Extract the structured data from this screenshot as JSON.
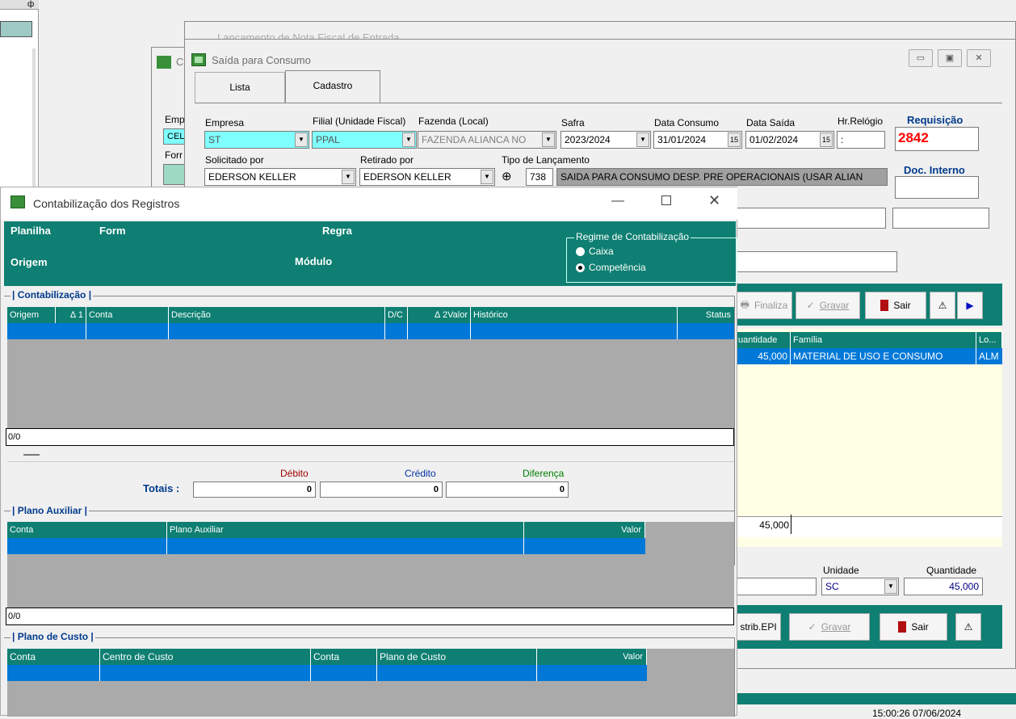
{
  "bg_window_title": "Lançamento de Nota Fiscal de Entrada",
  "small_window_title": "C",
  "small_window": {
    "emp_label": "Emp",
    "emp_value": "CEL",
    "form_label": "Forr"
  },
  "main_window": {
    "title": "Saída para Consumo",
    "tabs": [
      "Lista",
      "Cadastro"
    ],
    "labels": {
      "empresa": "Empresa",
      "filial": "Filial (Unidade Fiscal)",
      "fazenda": "Fazenda (Local)",
      "safra": "Safra",
      "data_consumo": "Data Consumo",
      "data_saida": "Data Saída",
      "hr_relogio": "Hr.Relógio",
      "requisicao": "Requisição",
      "solicitado": "Solicitado por",
      "retirado": "Retirado por",
      "tipo_lanc": "Tipo de Lançamento",
      "doc_interno": "Doc. Interno"
    },
    "values": {
      "empresa": "ST",
      "filial": "PPAL",
      "fazenda": "FAZENDA ALIANCA NO",
      "safra": "2023/2024",
      "data_consumo": "31/01/2024",
      "data_saida": "01/02/2024",
      "hr_relogio": ":",
      "requisicao": "2842",
      "solicitado": "EDERSON KELLER",
      "retirado": "EDERSON KELLER",
      "tipo_codigo": "738",
      "tipo_desc": "SAIDA PARA CONSUMO DESP. PRE OPERACIONAIS (USAR  ALIAN"
    },
    "toolbar": {
      "finaliza": "Finaliza",
      "gravar": "Gravar",
      "sair": "Sair"
    },
    "grid": {
      "headers": [
        "uantidade",
        "Família",
        "Lo..."
      ],
      "row": [
        "45,000",
        "MATERIAL DE USO E CONSUMO",
        "ALM"
      ],
      "total": "45,000"
    },
    "bottom": {
      "unidade_label": "Unidade",
      "quantidade_label": "Quantidade",
      "unidade": "SC",
      "quantidade": "45,000",
      "distrib": "strib.EPI",
      "gravar": "Gravar",
      "sair": "Sair"
    }
  },
  "contab": {
    "title": "Contabilização dos Registros",
    "header": {
      "planilha": "Planilha",
      "form": "Form",
      "regra": "Regra",
      "origem": "Origem",
      "modulo": "Módulo"
    },
    "regime": {
      "title": "Regime de Contabilização",
      "caixa": "Caixa",
      "competencia": "Competência",
      "selected": "Competência"
    },
    "section1": "| Contabilização |",
    "grid1_headers": [
      "Origem",
      "Conta",
      "Descrição",
      "D/C",
      "Valor",
      "Histórico",
      "Status"
    ],
    "grid1_sort": [
      "1",
      "2"
    ],
    "count1": "0/0",
    "totais": {
      "label": "Totais :",
      "debito_label": "Débito",
      "credito_label": "Crédito",
      "diferenca_label": "Diferença",
      "debito": "0",
      "credito": "0",
      "diferenca": "0"
    },
    "section2": "| Plano Auxiliar |",
    "grid2_headers": [
      "Conta",
      "Plano Auxiliar",
      "Valor"
    ],
    "count2": "0/0",
    "section3": "| Plano de Custo |",
    "grid3_headers": [
      "Conta",
      "Centro de Custo",
      "Conta",
      "Plano de Custo",
      "Valor"
    ]
  },
  "status_clock": "15:00:26  07/06/2024",
  "colors": {
    "teal": "#0e7f72",
    "selection": "#0078d7",
    "cream": "#ffffe6",
    "cyan": "#80ffff",
    "requisicao": "#ff0000"
  }
}
